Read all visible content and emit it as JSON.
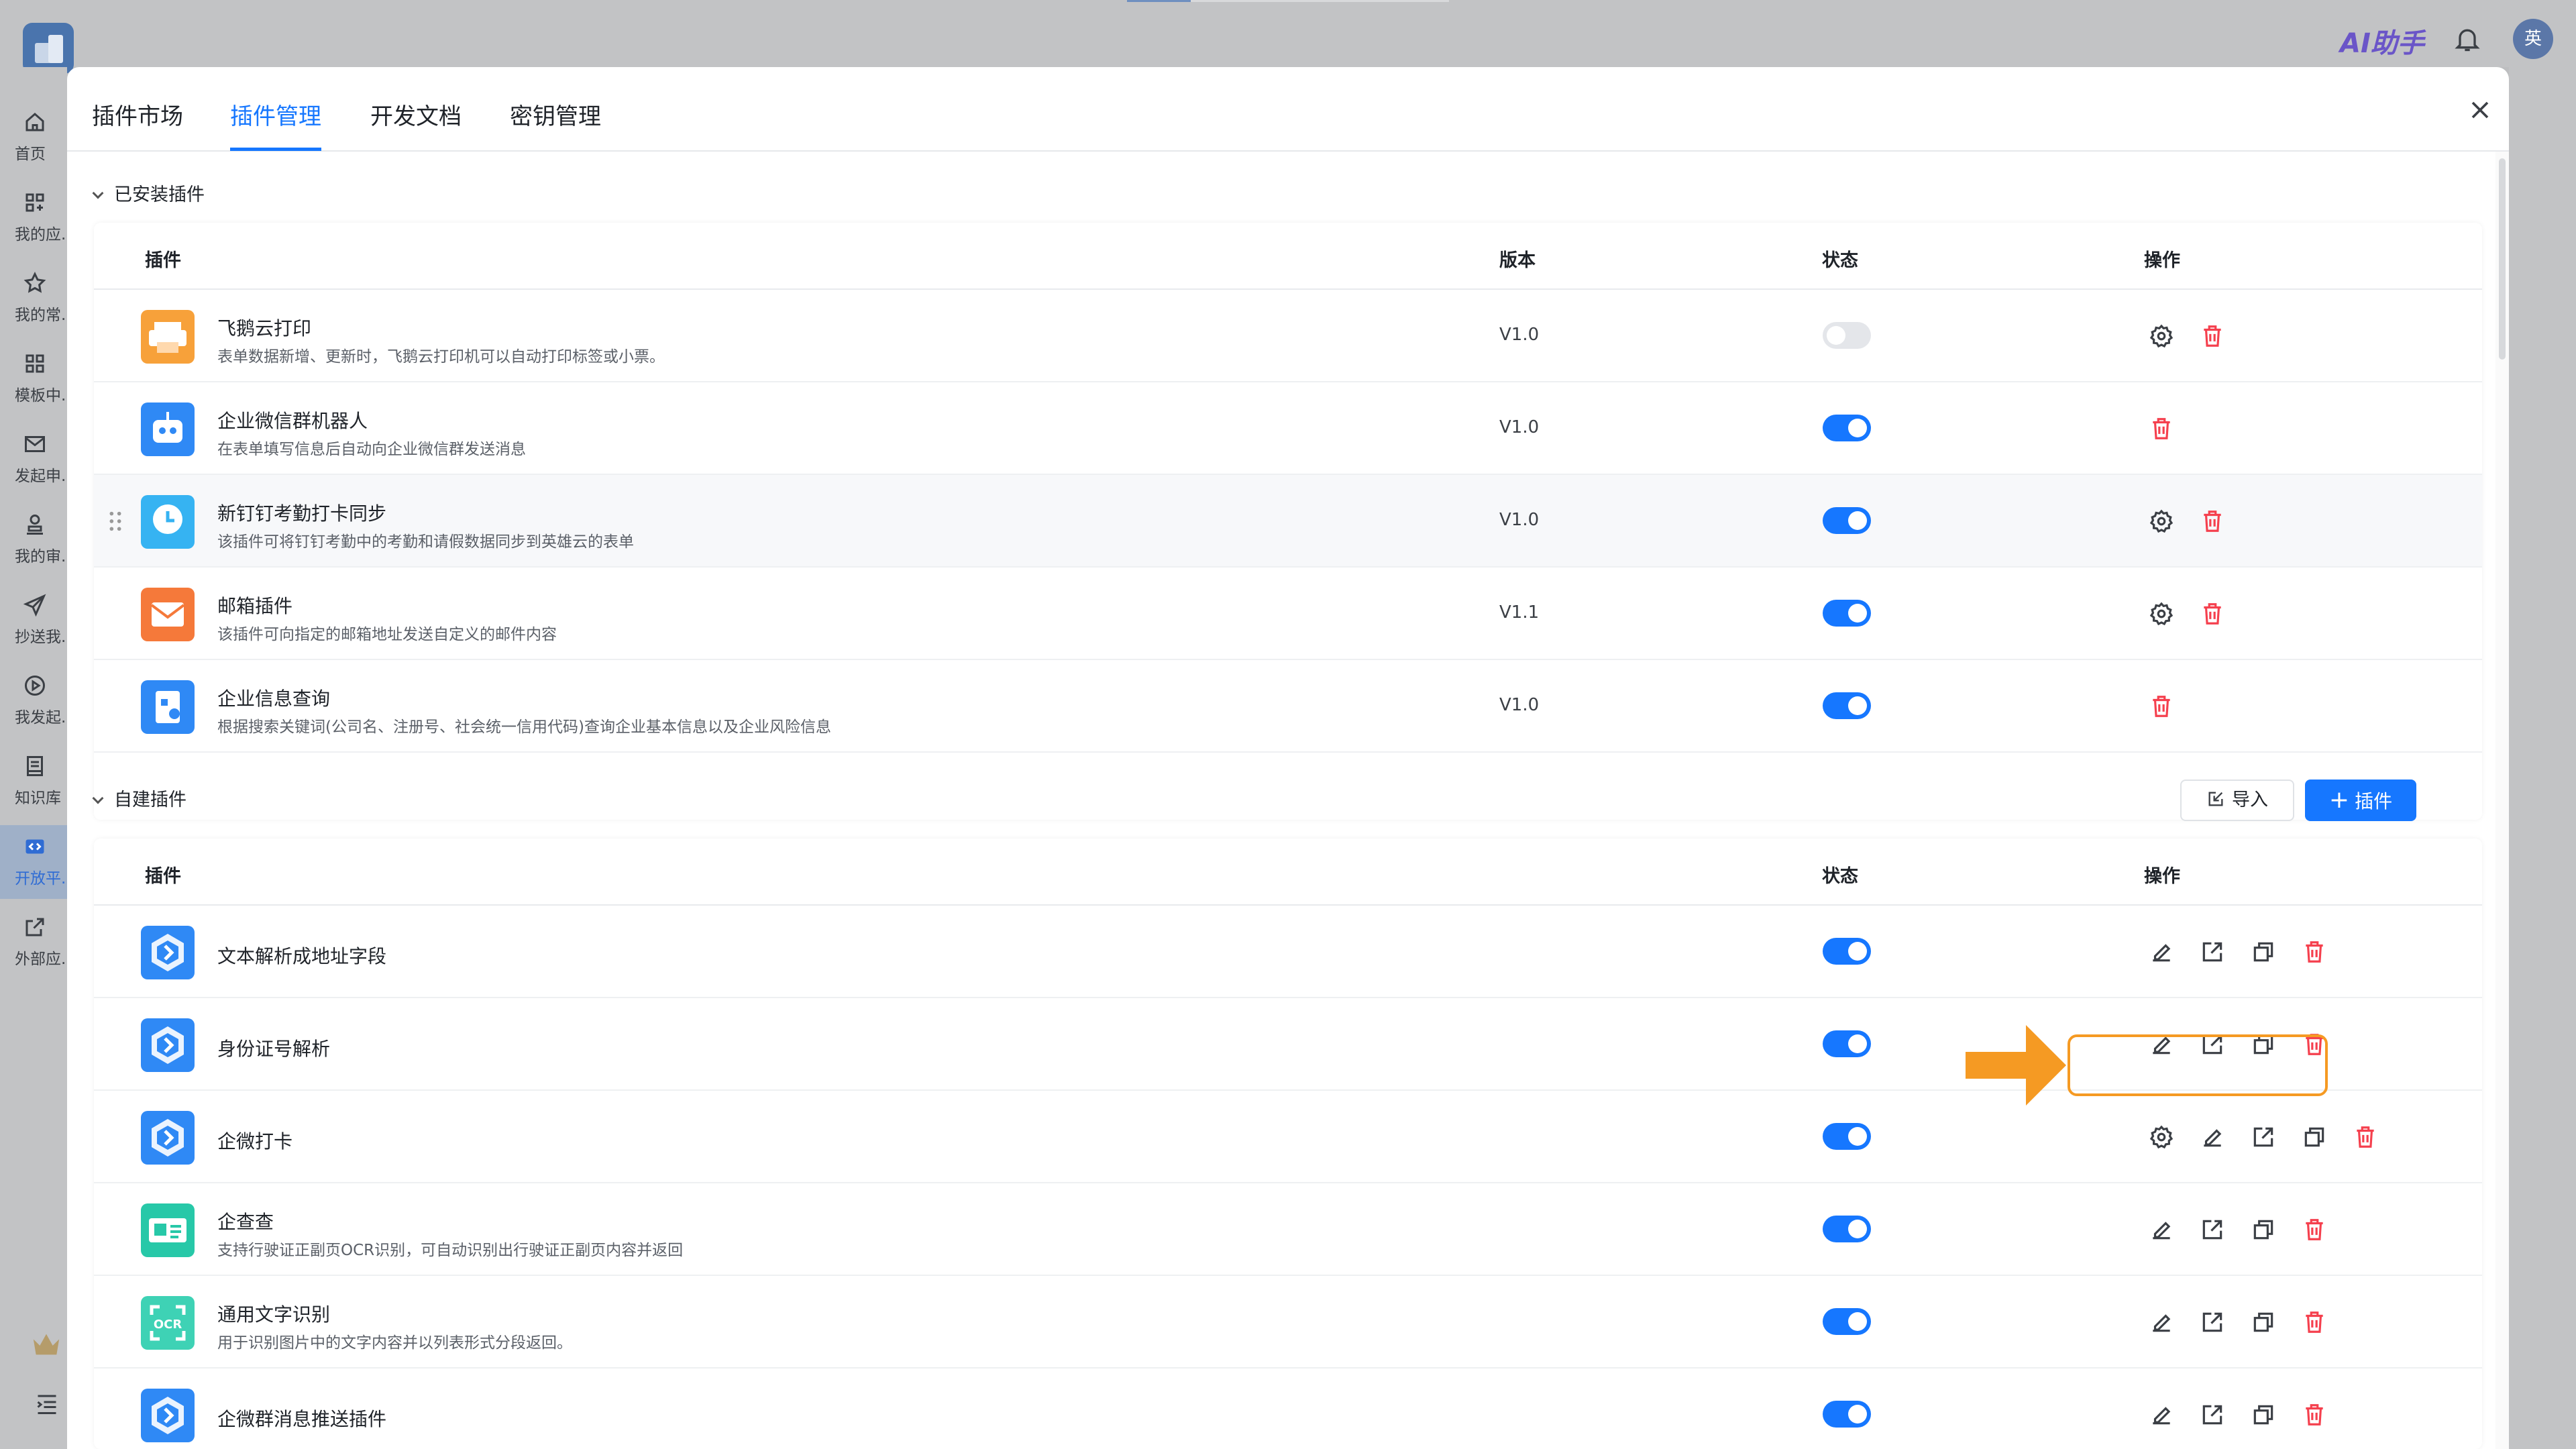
{
  "topbar": {
    "ai_label": "AI助手",
    "avatar_text": "英"
  },
  "sidebar": {
    "items": [
      {
        "label": "首页",
        "icon": "home-icon"
      },
      {
        "label": "我的应...",
        "icon": "apps-icon"
      },
      {
        "label": "我的常...",
        "icon": "star-icon"
      },
      {
        "label": "模板中...",
        "icon": "template-icon"
      },
      {
        "label": "发起申...",
        "icon": "mail-icon"
      },
      {
        "label": "我的审...",
        "icon": "approval-icon"
      },
      {
        "label": "抄送我...",
        "icon": "send-icon"
      },
      {
        "label": "我发起...",
        "icon": "play-icon"
      },
      {
        "label": "知识库",
        "icon": "book-icon"
      },
      {
        "label": "开放平...",
        "icon": "code-icon"
      },
      {
        "label": "外部应...",
        "icon": "external-icon"
      }
    ]
  },
  "tabs": [
    "插件市场",
    "插件管理",
    "开发文档",
    "密钥管理"
  ],
  "installed": {
    "title": "已安装插件",
    "columns": {
      "plugin": "插件",
      "version": "版本",
      "status": "状态",
      "ops": "操作"
    },
    "rows": [
      {
        "name": "飞鹅云打印",
        "desc": "表单数据新增、更新时，飞鹅云打印机可以自动打印标签或小票。",
        "version": "V1.0",
        "enabled": false,
        "icon_color": "#f7a13a",
        "icon": "printer-icon",
        "settings": true
      },
      {
        "name": "企业微信群机器人",
        "desc": "在表单填写信息后自动向企业微信群发送消息",
        "version": "V1.0",
        "enabled": true,
        "icon_color": "#2f89f5",
        "icon": "robot-icon",
        "settings": false
      },
      {
        "name": "新钉钉考勤打卡同步",
        "desc": "该插件可将钉钉考勤中的考勤和请假数据同步到英雄云的表单",
        "version": "V1.0",
        "enabled": true,
        "icon_color": "#36b3f2",
        "icon": "clock-icon",
        "settings": true
      },
      {
        "name": "邮箱插件",
        "desc": "该插件可向指定的邮箱地址发送自定义的邮件内容",
        "version": "V1.1",
        "enabled": true,
        "icon_color": "#f5793a",
        "icon": "envelope-icon",
        "settings": true
      },
      {
        "name": "企业信息查询",
        "desc": "根据搜索关键词(公司名、注册号、社会统一信用代码)查询企业基本信息以及企业风险信息",
        "version": "V1.0",
        "enabled": true,
        "icon_color": "#2f89f5",
        "icon": "company-icon",
        "settings": false
      }
    ]
  },
  "custom": {
    "title": "自建插件",
    "import_label": "导入",
    "add_label": "插件",
    "columns": {
      "plugin": "插件",
      "status": "状态",
      "ops": "操作"
    },
    "rows": [
      {
        "name": "文本解析成地址字段",
        "desc": "",
        "enabled": true,
        "icon_color": "#2f89f5",
        "icon": "plugin-icon",
        "settings": false
      },
      {
        "name": "身份证号解析",
        "desc": "",
        "enabled": true,
        "icon_color": "#2f89f5",
        "icon": "plugin-icon",
        "settings": false
      },
      {
        "name": "企微打卡",
        "desc": "",
        "enabled": true,
        "icon_color": "#2f89f5",
        "icon": "plugin-icon",
        "settings": true
      },
      {
        "name": "企查查",
        "desc": "支持行驶证正副页OCR识别，可自动识别出行驶证正副页内容并返回",
        "enabled": true,
        "icon_color": "#27c8a8",
        "icon": "card-icon",
        "settings": false
      },
      {
        "name": "通用文字识别",
        "desc": "用于识别图片中的文字内容并以列表形式分段返回。",
        "enabled": true,
        "icon_color": "#3ed2b5",
        "icon": "ocr-icon",
        "settings": false
      },
      {
        "name": "企微群消息推送插件",
        "desc": "",
        "enabled": true,
        "icon_color": "#2f89f5",
        "icon": "plugin-icon",
        "settings": false
      }
    ]
  }
}
